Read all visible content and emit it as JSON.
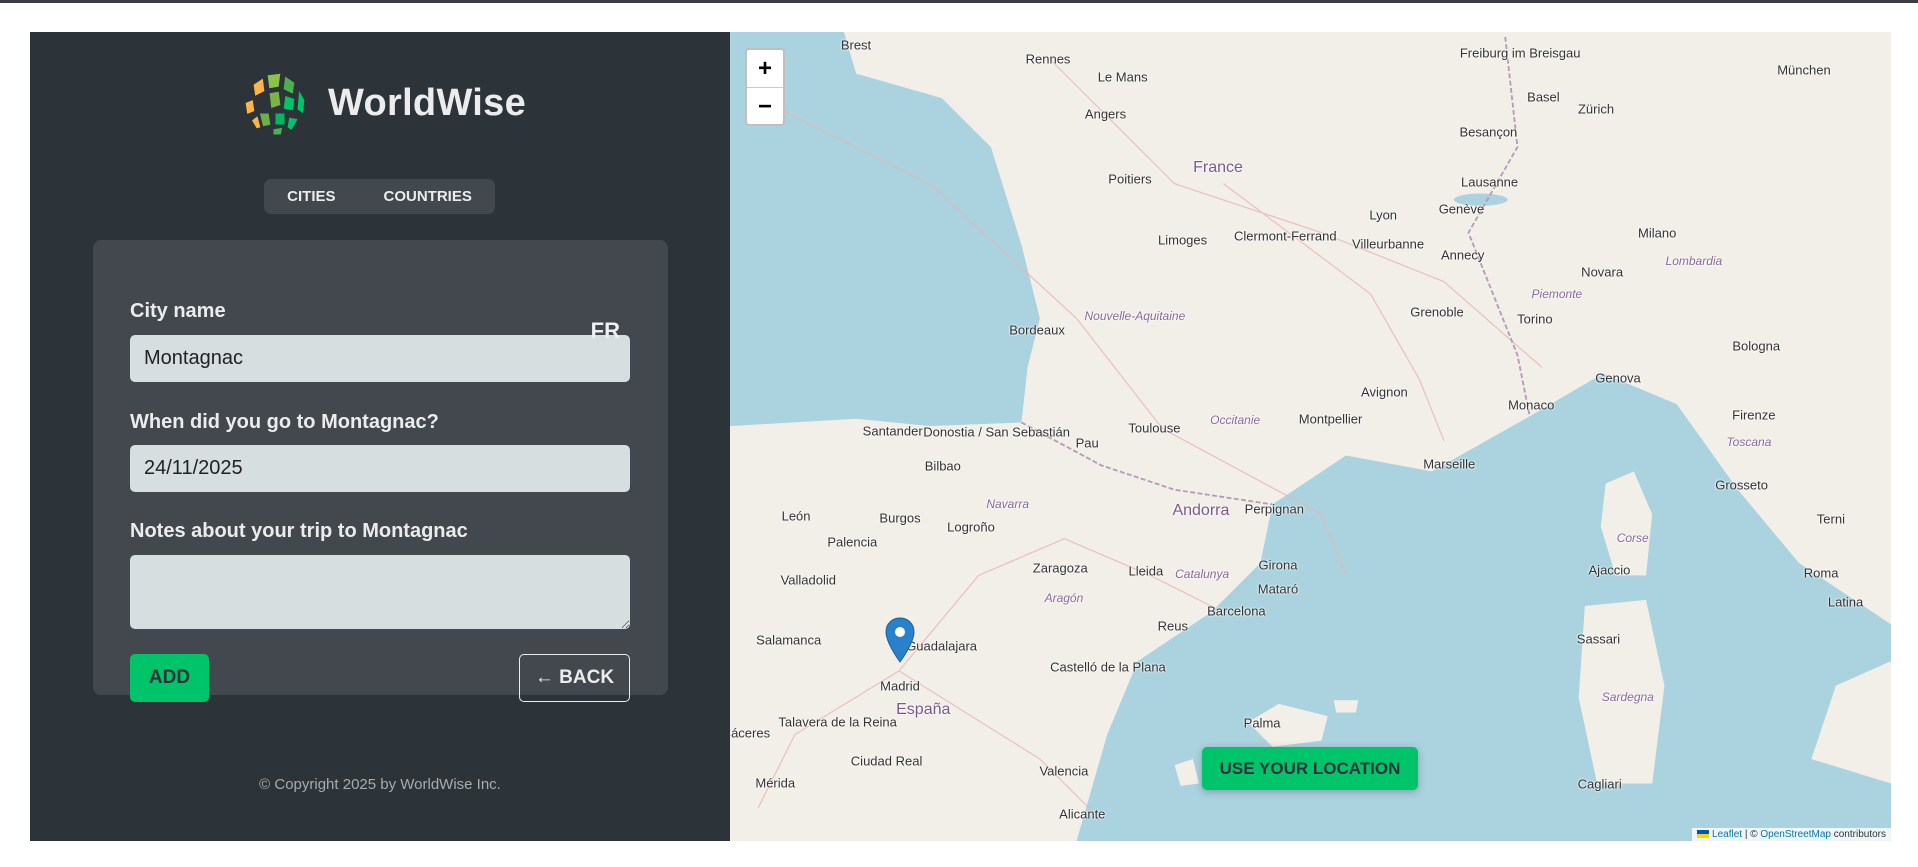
{
  "app": {
    "name": "WorldWise"
  },
  "tabs": [
    {
      "label": "CITIES"
    },
    {
      "label": "COUNTRIES"
    }
  ],
  "form": {
    "city_label": "City name",
    "city_value": "Montagnac",
    "country_flag": "FR",
    "date_label": "When did you go to Montagnac?",
    "date_value": "24/11/2025",
    "notes_label": "Notes about your trip to Montagnac",
    "notes_value": "",
    "add_label": "ADD",
    "back_label": "← BACK"
  },
  "footer": {
    "copyright": "© Copyright 2025 by WorldWise Inc."
  },
  "map": {
    "zoom_in": "+",
    "zoom_out": "−",
    "use_location": "USE YOUR LOCATION",
    "attribution": {
      "leaflet": "Leaflet",
      "sep": " | © ",
      "osm": "OpenStreetMap",
      "suffix": " contributors"
    },
    "colors": {
      "land": "#f2efe9",
      "sea": "#aad3df",
      "accent": "#00c46a",
      "marker": "#2a81cb"
    },
    "labels": [
      "Brest",
      "Rennes",
      "Le Mans",
      "Angers",
      "Poitiers",
      "Limoges",
      "France",
      "Bordeaux",
      "Toulouse",
      "Clermont-Ferrand",
      "Lyon",
      "Villeurbanne",
      "Grenoble",
      "Genève",
      "Lausanne",
      "Annecy",
      "Basel",
      "Zürich",
      "Freiburg im Breisgau",
      "München",
      "Besançon",
      "Avignon",
      "Montpellier",
      "Marseille",
      "Monaco",
      "Genova",
      "Milano",
      "Torino",
      "Novara",
      "Bologna",
      "Firenze",
      "Perpignan",
      "Andorra",
      "Pau",
      "Donostia / San Sebastián",
      "Santander",
      "Bilbao",
      "Burgos",
      "León",
      "Palencia",
      "Valladolid",
      "Logroño",
      "Zaragoza",
      "Lleida",
      "Girona",
      "Barcelona",
      "Reus",
      "Mataró",
      "Madrid",
      "España",
      "Guadalajara",
      "Salamanca",
      "Talavera de la Reina",
      "Ciudad Real",
      "Cáceres",
      "Mérida",
      "Castelló de la Plana",
      "Palma",
      "Valencia",
      "Alicante",
      "Ajaccio",
      "Sassari",
      "Cagliari",
      "Roma",
      "Terni",
      "Grosseto",
      "Latina",
      "Nouvelle-Aquitaine",
      "Occitanie",
      "Catalunya",
      "Aragón",
      "Navarra",
      "Corse",
      "Sardegna",
      "Toscana",
      "Lombardia",
      "Piemonte"
    ]
  }
}
